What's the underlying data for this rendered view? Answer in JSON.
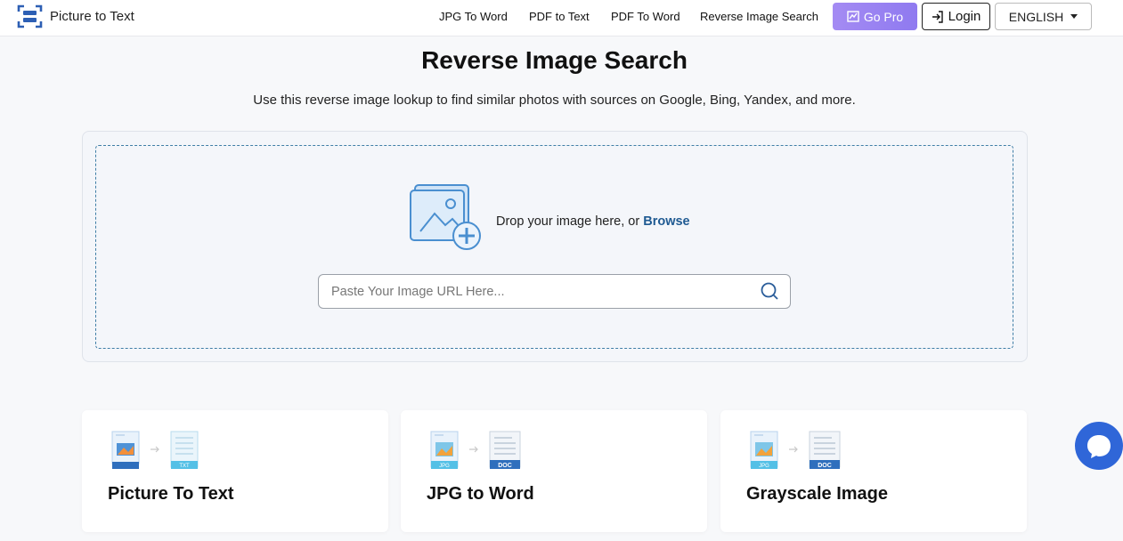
{
  "header": {
    "logo_text": "Picture to Text",
    "nav": [
      {
        "label": "JPG To Word"
      },
      {
        "label": "PDF to Text"
      },
      {
        "label": "PDF To Word"
      },
      {
        "label": "Reverse Image Search"
      }
    ],
    "gopro_label": "Go Pro",
    "login_label": "Login",
    "language": "ENGLISH"
  },
  "hero": {
    "title": "Reverse Image Search",
    "subtitle": "Use this reverse image lookup to find similar photos with sources on Google, Bing, Yandex, and more."
  },
  "upload": {
    "drop_text": "Drop your image here, or",
    "browse_label": "Browse",
    "url_placeholder": "Paste Your Image URL Here...",
    "url_value": ""
  },
  "cards": [
    {
      "title": "Picture To Text",
      "target_badge": "TXT"
    },
    {
      "title": "JPG to Word",
      "source_badge": "JPG",
      "target_badge": "DOC"
    },
    {
      "title": "Grayscale Image",
      "source_badge": "JPG",
      "target_badge": "DOC"
    }
  ],
  "colors": {
    "accent": "#1f5a92",
    "gopro": "#9b84f2",
    "chat": "#2f66d8",
    "dashed_border": "#3f7ea6"
  },
  "icons": {
    "logo": "scan-icon",
    "gopro": "crown-chart-icon",
    "login": "login-arrow-icon",
    "search": "search-icon",
    "drop": "image-add-icon",
    "chat": "chat-icon"
  }
}
